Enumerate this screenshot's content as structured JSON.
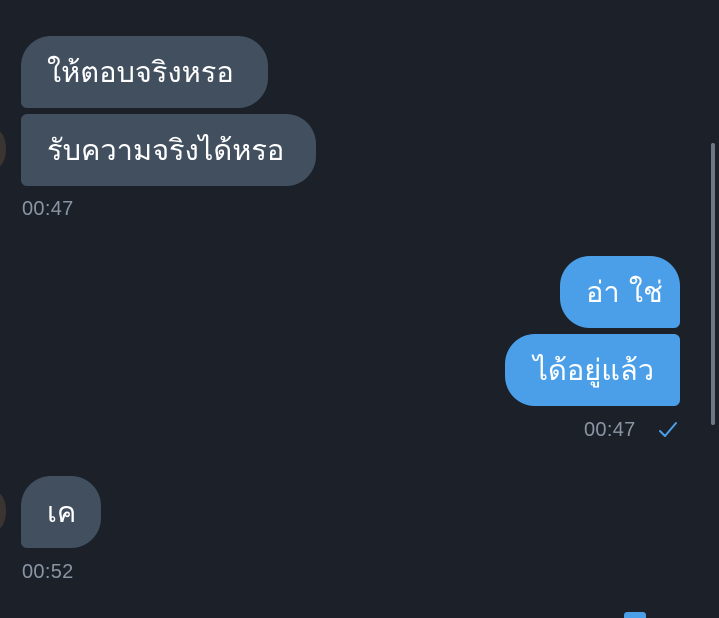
{
  "messages": [
    {
      "text": "ให้ตอบจริงหรอ",
      "direction": "incoming"
    },
    {
      "text": "รับความจริงได้หรอ",
      "direction": "incoming"
    },
    {
      "text": "อ่า ใช่",
      "direction": "outgoing"
    },
    {
      "text": "ได้อยู่แล้ว",
      "direction": "outgoing"
    },
    {
      "text": "เค",
      "direction": "incoming"
    }
  ],
  "timestamps": {
    "group1": "00:47",
    "group2": "00:47",
    "group3": "00:52"
  },
  "status": {
    "group2": "sent-check-icon"
  },
  "colors": {
    "background": "#1b2029",
    "incoming_bubble": "#414f5f",
    "outgoing_bubble": "#4b9fe8",
    "timestamp": "#8a95a3",
    "check": "#4b9fe8"
  }
}
